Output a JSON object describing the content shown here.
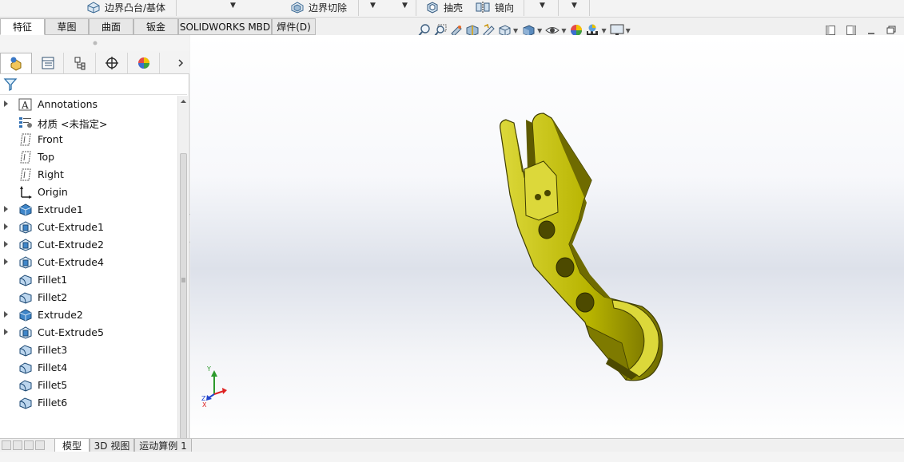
{
  "command_bar": {
    "boundary_boss": "边界凸台/基体",
    "boundary_cut": "边界切除",
    "shell": "抽壳",
    "mirror": "镜向"
  },
  "command_tabs": [
    {
      "label": "特征",
      "active": true
    },
    {
      "label": "草图",
      "active": false
    },
    {
      "label": "曲面",
      "active": false
    },
    {
      "label": "钣金",
      "active": false
    },
    {
      "label": "SOLIDWORKS MBD",
      "active": false
    },
    {
      "label": "焊件(D)",
      "active": false
    }
  ],
  "manager_tabs": [
    {
      "icon": "feature-manager-icon",
      "active": true
    },
    {
      "icon": "property-manager-icon",
      "active": false
    },
    {
      "icon": "configuration-manager-icon",
      "active": false
    },
    {
      "icon": "dimxpert-manager-icon",
      "active": false
    },
    {
      "icon": "display-manager-icon",
      "active": false
    }
  ],
  "feature_tree": [
    {
      "label": "Annotations",
      "icon": "annotations-icon",
      "expandable": true
    },
    {
      "label": "材质 <未指定>",
      "icon": "material-icon",
      "expandable": false
    },
    {
      "label": "Front",
      "icon": "plane-icon",
      "expandable": false
    },
    {
      "label": "Top",
      "icon": "plane-icon",
      "expandable": false
    },
    {
      "label": "Right",
      "icon": "plane-icon",
      "expandable": false
    },
    {
      "label": "Origin",
      "icon": "origin-icon",
      "expandable": false
    },
    {
      "label": "Extrude1",
      "icon": "extrude-icon",
      "expandable": true
    },
    {
      "label": "Cut-Extrude1",
      "icon": "cut-extrude-icon",
      "expandable": true
    },
    {
      "label": "Cut-Extrude2",
      "icon": "cut-extrude-icon",
      "expandable": true
    },
    {
      "label": "Cut-Extrude4",
      "icon": "cut-extrude-icon",
      "expandable": true
    },
    {
      "label": "Fillet1",
      "icon": "fillet-icon",
      "expandable": false
    },
    {
      "label": "Fillet2",
      "icon": "fillet-icon",
      "expandable": false
    },
    {
      "label": "Extrude2",
      "icon": "extrude-icon",
      "expandable": true
    },
    {
      "label": "Cut-Extrude5",
      "icon": "cut-extrude-icon",
      "expandable": true
    },
    {
      "label": "Fillet3",
      "icon": "fillet-icon",
      "expandable": false
    },
    {
      "label": "Fillet4",
      "icon": "fillet-icon",
      "expandable": false
    },
    {
      "label": "Fillet5",
      "icon": "fillet-icon",
      "expandable": false
    },
    {
      "label": "Fillet6",
      "icon": "fillet-icon",
      "expandable": false
    }
  ],
  "bottom_tabs": [
    {
      "label": "模型",
      "active": true
    },
    {
      "label": "3D 视图",
      "active": false
    },
    {
      "label": "运动算例 1",
      "active": false
    }
  ],
  "triad": {
    "x": "X",
    "y": "Y",
    "z": "Z"
  },
  "colors": {
    "part": "#b8b400",
    "part_dark": "#6f6b00",
    "part_light": "#dcd83a",
    "accent": "#1f6fb3"
  }
}
